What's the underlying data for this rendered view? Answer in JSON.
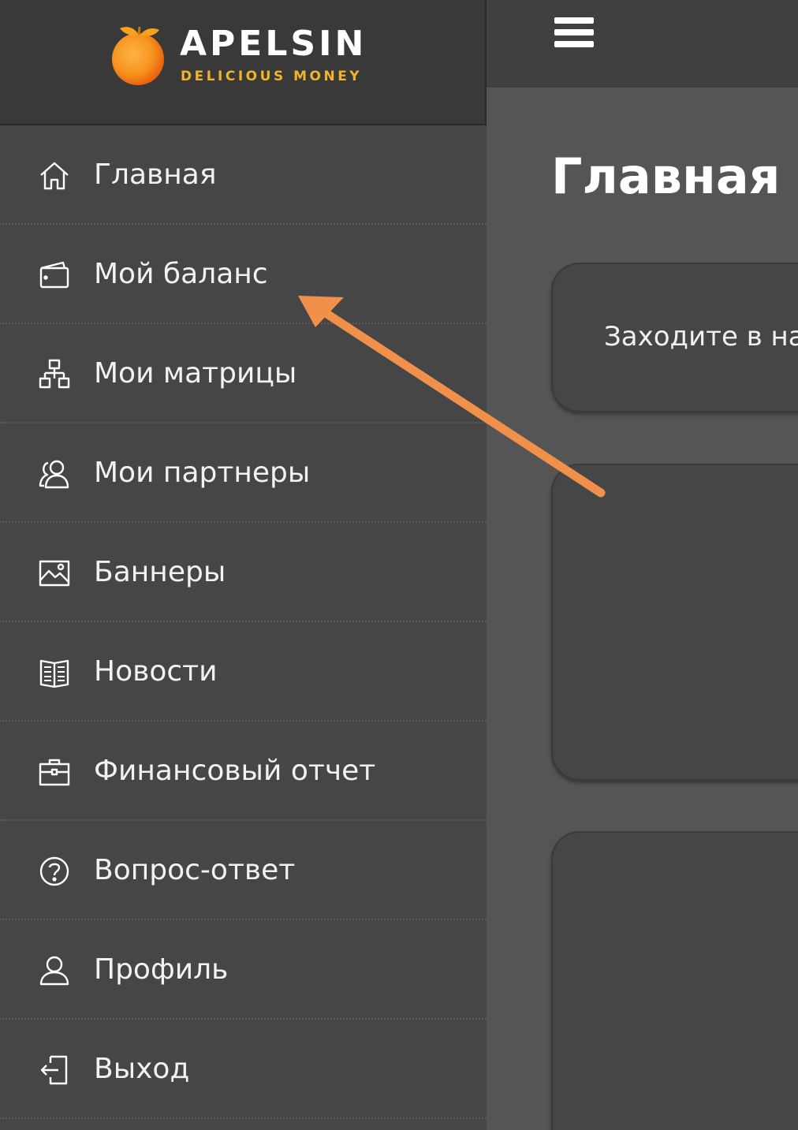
{
  "brand": {
    "name": "APELSIN",
    "tagline": "DELICIOUS MONEY",
    "tagline_color": "#f0b429",
    "logo_color": "#f7931e"
  },
  "sidebar": {
    "items": [
      {
        "label": "Главная",
        "icon": "home-icon"
      },
      {
        "label": "Мой баланс",
        "icon": "wallet-icon"
      },
      {
        "label": "Мои матрицы",
        "icon": "structure-icon"
      },
      {
        "label": "Мои партнеры",
        "icon": "partners-icon"
      },
      {
        "label": "Баннеры",
        "icon": "image-icon"
      },
      {
        "label": "Новости",
        "icon": "book-icon"
      },
      {
        "label": "Финансовый отчет",
        "icon": "briefcase-icon"
      },
      {
        "label": "Вопрос-ответ",
        "icon": "question-icon"
      },
      {
        "label": "Профиль",
        "icon": "user-icon"
      },
      {
        "label": "Выход",
        "icon": "logout-icon"
      }
    ]
  },
  "header": {
    "menu_icon": "hamburger-icon"
  },
  "main": {
    "title": "Главная",
    "cards": [
      {
        "text": "Заходите в на"
      },
      {
        "text": ""
      },
      {
        "text": ""
      }
    ]
  },
  "annotation": {
    "arrow_color": "#f0904a",
    "arrow_icon": "annotation-arrow-icon"
  }
}
